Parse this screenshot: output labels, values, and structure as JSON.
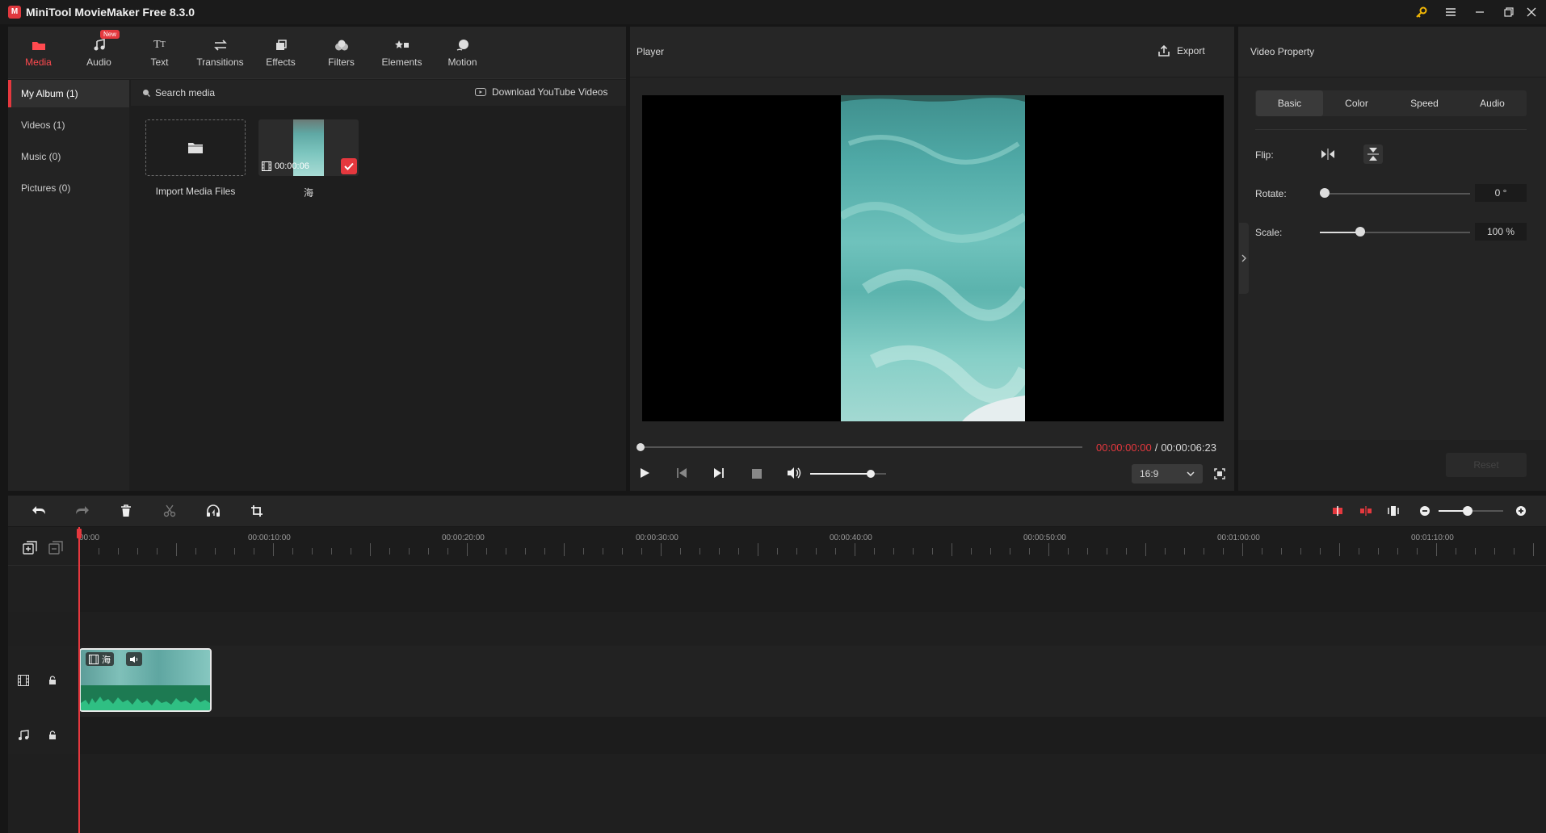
{
  "app": {
    "title": "MiniTool MovieMaker Free 8.3.0",
    "logo": "M"
  },
  "toolbar": {
    "tabs": [
      {
        "label": "Media",
        "icon": "folder-icon",
        "active": true
      },
      {
        "label": "Audio",
        "icon": "music-note-icon"
      },
      {
        "label": "Text",
        "icon": "text-icon"
      },
      {
        "label": "Transitions",
        "icon": "transitions-icon"
      },
      {
        "label": "Effects",
        "icon": "effects-icon"
      },
      {
        "label": "Filters",
        "icon": "filters-icon"
      },
      {
        "label": "Elements",
        "icon": "elements-icon"
      },
      {
        "label": "Motion",
        "icon": "motion-icon"
      }
    ],
    "new_badge": "New"
  },
  "sidebar": {
    "items": [
      {
        "label": "My Album (1)",
        "active": true
      },
      {
        "label": "Videos (1)"
      },
      {
        "label": "Music (0)"
      },
      {
        "label": "Pictures (0)"
      }
    ]
  },
  "media": {
    "search_label": "Search media",
    "download_label": "Download YouTube Videos",
    "import_label": "Import Media Files",
    "clip": {
      "duration": "00:00:06",
      "name": "海"
    }
  },
  "player": {
    "title": "Player",
    "export_label": "Export",
    "current_time": "00:00:00:00",
    "separator": "/",
    "total_time": "00:00:06:23",
    "aspect_ratio": "16:9",
    "volume_fraction": 0.8
  },
  "properties": {
    "title": "Video Property",
    "tabs": [
      {
        "label": "Basic",
        "active": true
      },
      {
        "label": "Color"
      },
      {
        "label": "Speed"
      },
      {
        "label": "Audio"
      }
    ],
    "flip_label": "Flip:",
    "rotate_label": "Rotate:",
    "rotate_value": "0 °",
    "rotate_fraction": 0,
    "scale_label": "Scale:",
    "scale_value": "100 %",
    "scale_fraction": 0.27,
    "reset_label": "Reset"
  },
  "timeline": {
    "ruler": [
      "00:00",
      "00:00:10:00",
      "00:00:20:00",
      "00:00:30:00",
      "00:00:40:00",
      "00:00:50:00",
      "00:01:00:00",
      "00:01:10:00"
    ],
    "clip_name": "海",
    "zoom_fraction": 0.45
  },
  "colors": {
    "accent": "#e5383e",
    "panel": "#242424",
    "background": "#161616",
    "waveform": "#27a06a"
  }
}
